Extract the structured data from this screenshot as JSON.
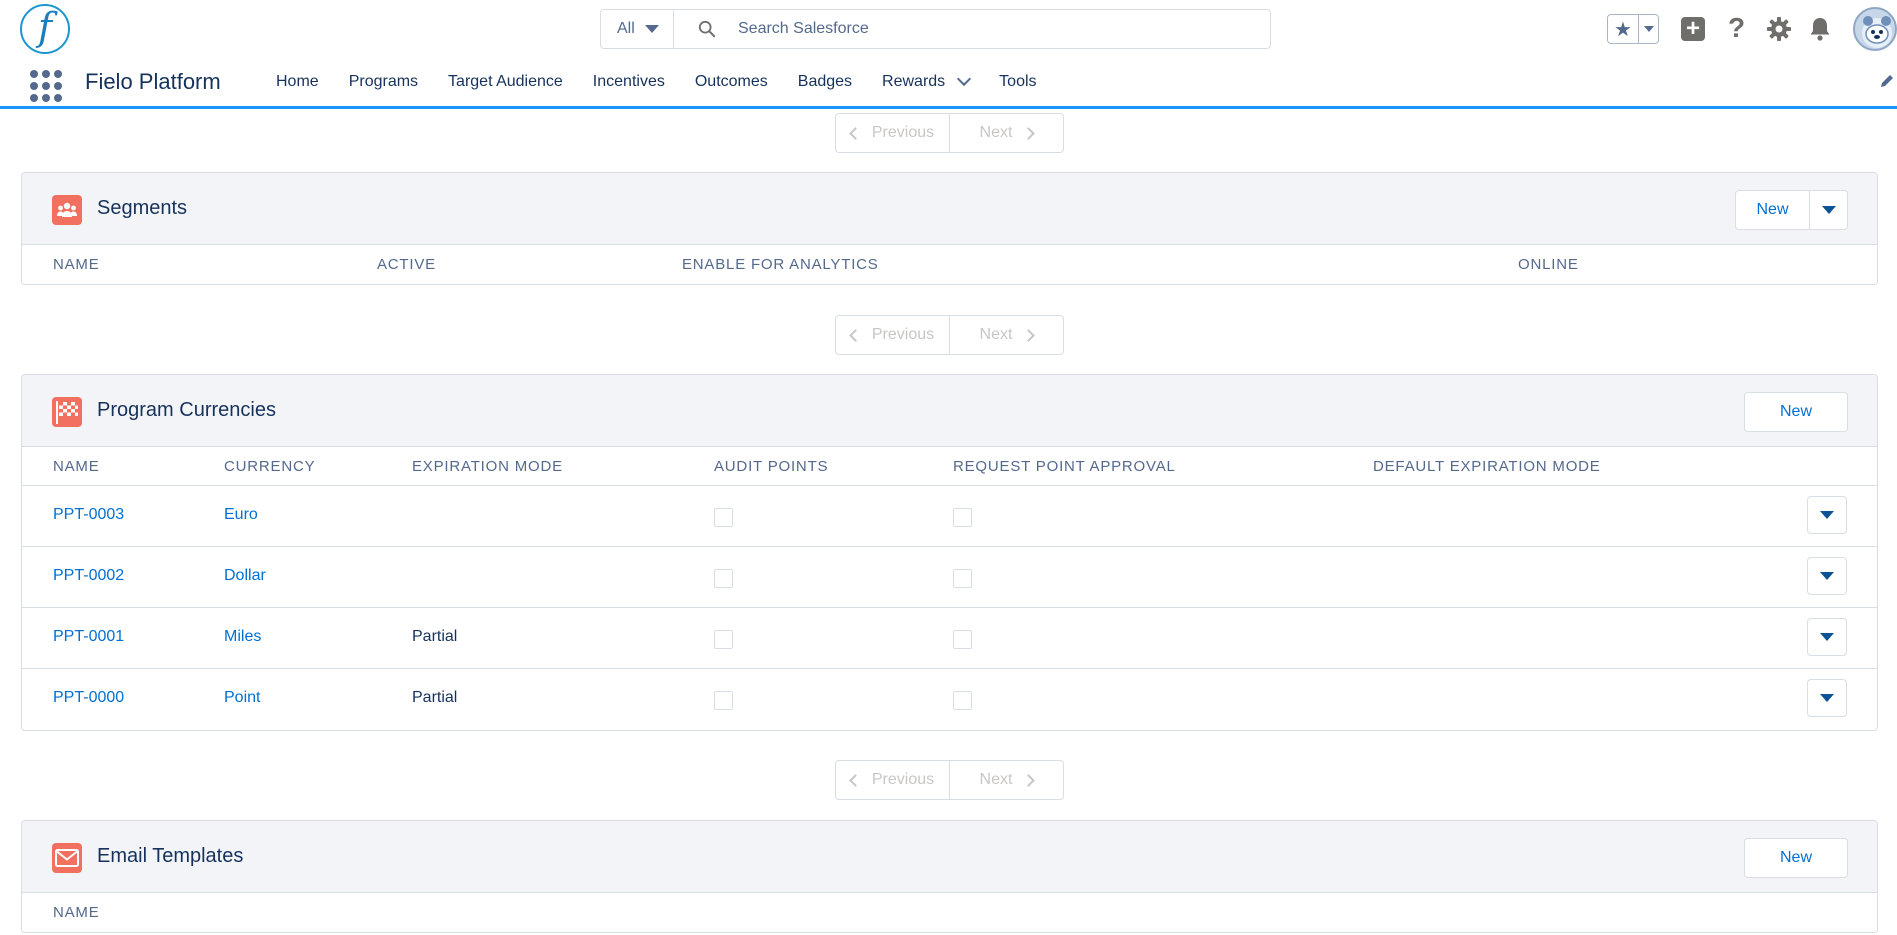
{
  "header": {
    "search_scope": "All",
    "search_placeholder": "Search Salesforce"
  },
  "nav": {
    "app_name": "Fielo Platform",
    "items": [
      {
        "label": "Home"
      },
      {
        "label": "Programs"
      },
      {
        "label": "Target Audience"
      },
      {
        "label": "Incentives"
      },
      {
        "label": "Outcomes"
      },
      {
        "label": "Badges"
      },
      {
        "label": "Rewards"
      },
      {
        "label": "Tools"
      }
    ]
  },
  "pager": {
    "previous_label": "Previous",
    "next_label": "Next"
  },
  "segments": {
    "title": "Segments",
    "new_label": "New",
    "columns": [
      "Name",
      "Active",
      "Enable for Analytics",
      "Online"
    ]
  },
  "currencies": {
    "title": "Program Currencies",
    "new_label": "New",
    "columns": [
      "Name",
      "Currency",
      "Expiration Mode",
      "Audit Points",
      "Request Point Approval",
      "Default Expiration Mode"
    ],
    "rows": [
      {
        "name": "PPT-0003",
        "currency": "Euro",
        "expiration_mode": "",
        "audit_points": false,
        "request_point_approval": false,
        "default_expiration_mode": ""
      },
      {
        "name": "PPT-0002",
        "currency": "Dollar",
        "expiration_mode": "",
        "audit_points": false,
        "request_point_approval": false,
        "default_expiration_mode": ""
      },
      {
        "name": "PPT-0001",
        "currency": "Miles",
        "expiration_mode": "Partial",
        "audit_points": false,
        "request_point_approval": false,
        "default_expiration_mode": ""
      },
      {
        "name": "PPT-0000",
        "currency": "Point",
        "expiration_mode": "Partial",
        "audit_points": false,
        "request_point_approval": false,
        "default_expiration_mode": ""
      }
    ]
  },
  "email_templates": {
    "title": "Email Templates",
    "new_label": "New",
    "columns": [
      "Name"
    ]
  },
  "colors": {
    "brand_blue": "#1b96ff",
    "link": "#0070d2",
    "icon_orange": "#f2705f",
    "text": "#16325c",
    "muted": "#54698d"
  }
}
